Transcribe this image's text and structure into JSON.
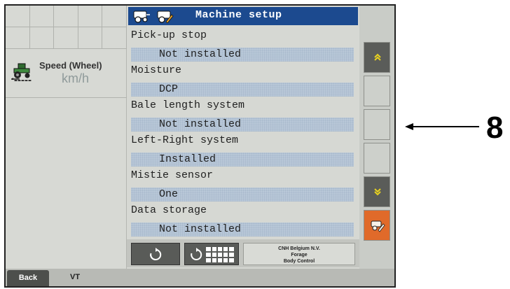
{
  "colors": {
    "header_bg": "#1c4a8f",
    "value_bg": "#b9c8d8",
    "softkey_dark": "#5a5c59",
    "softkey_orange": "#e06a2a",
    "tab_back": "#4d4f4c"
  },
  "dialog": {
    "title": "Machine setup",
    "settings": [
      {
        "label": "Pick-up stop",
        "value": "Not installed"
      },
      {
        "label": "Moisture",
        "value": "DCP"
      },
      {
        "label": "Bale length system",
        "value": "Not installed"
      },
      {
        "label": "Left-Right system",
        "value": "Installed"
      },
      {
        "label": "Mistie sensor",
        "value": "One"
      },
      {
        "label": "Data storage",
        "value": "Not installed"
      }
    ],
    "footer": {
      "refresh_icon": "refresh-icon",
      "refresh_grid_icon": "refresh-grid-icon",
      "company_line1": "CNH Belgium N.V.",
      "company_line2": "Forage",
      "company_line3": "Body Control"
    }
  },
  "left_panel": {
    "speed_title": "Speed (Wheel)",
    "speed_value": "-----",
    "speed_unit": "km/h",
    "icon": "tractor-icon"
  },
  "bottom_tabs": {
    "back_label": "Back",
    "vt_label": "VT"
  },
  "softkeys": [
    {
      "name": "page-up",
      "icon": "double-chevron-up-icon"
    },
    {
      "name": "blank-1",
      "icon": ""
    },
    {
      "name": "blank-2",
      "icon": ""
    },
    {
      "name": "blank-3",
      "icon": ""
    },
    {
      "name": "page-down",
      "icon": "double-chevron-down-icon"
    },
    {
      "name": "machine-setup",
      "icon": "baler-wrench-icon"
    }
  ],
  "annotation": {
    "callout_number": "8"
  }
}
